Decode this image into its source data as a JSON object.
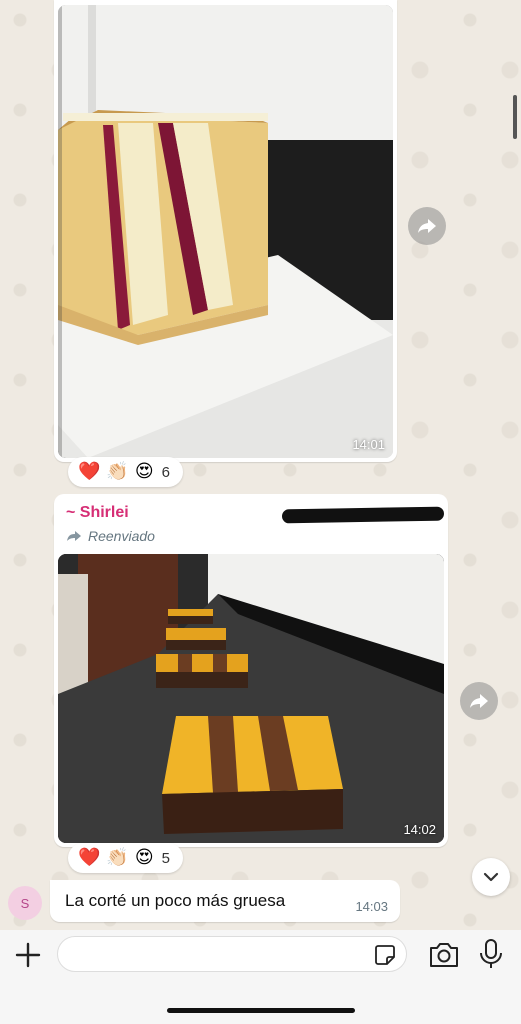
{
  "messages": [
    {
      "type": "image",
      "image_description": "cake slice",
      "time": "14:01",
      "reactions": {
        "emojis": [
          "❤️",
          "👏🏻",
          "😍"
        ],
        "count": "6"
      }
    },
    {
      "type": "image",
      "sender": "~ Shirlei",
      "forwarded_label": "Reenviado",
      "image_description": "cake bars",
      "time": "14:02",
      "reactions": {
        "emojis": [
          "❤️",
          "👏🏻",
          "😍"
        ],
        "count": "5"
      }
    },
    {
      "type": "text",
      "avatar_initial": "S",
      "text": "La corté un poco más gruesa",
      "time": "14:03"
    }
  ],
  "composer": {
    "placeholder": ""
  },
  "colors": {
    "sender_name": "#d62e75",
    "wallpaper": "#efeae2"
  }
}
